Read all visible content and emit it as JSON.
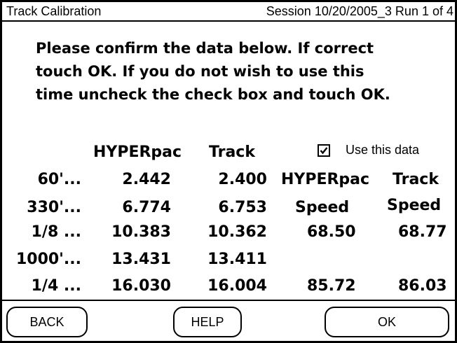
{
  "title_bar": {
    "title": "Track Calibration",
    "session": "Session 10/20/2005_3 Run 1 of 4"
  },
  "instructions": "Please confirm the data below.  If correct\ntouch OK.  If you do not wish to use this\ntime uncheck the check box and touch OK.",
  "table": {
    "headers": {
      "hyperpac": "HYPERpac",
      "track": "Track"
    },
    "rows": [
      {
        "label": "60'...",
        "hyperpac": "2.442",
        "track": "2.400"
      },
      {
        "label": "330'...",
        "hyperpac": "6.774",
        "track": "6.753"
      },
      {
        "label": "1/8 ...",
        "hyperpac": "10.383",
        "track": "10.362"
      },
      {
        "label": "1000'...",
        "hyperpac": "13.431",
        "track": "13.411"
      },
      {
        "label": "1/4 ...",
        "hyperpac": "16.030",
        "track": "16.004"
      }
    ]
  },
  "use_data": {
    "label": "Use this data",
    "checked": true
  },
  "speed": {
    "header_top": {
      "hyperpac": "HYPERpac",
      "track": "Track"
    },
    "header_bottom": {
      "hyperpac": "Speed",
      "track": "Speed"
    },
    "eighth": {
      "hyperpac": "68.50",
      "track": "68.77"
    },
    "quarter": {
      "hyperpac": "85.72",
      "track": "86.03"
    }
  },
  "buttons": {
    "back": "BACK",
    "help": "HELP",
    "ok": "OK"
  }
}
